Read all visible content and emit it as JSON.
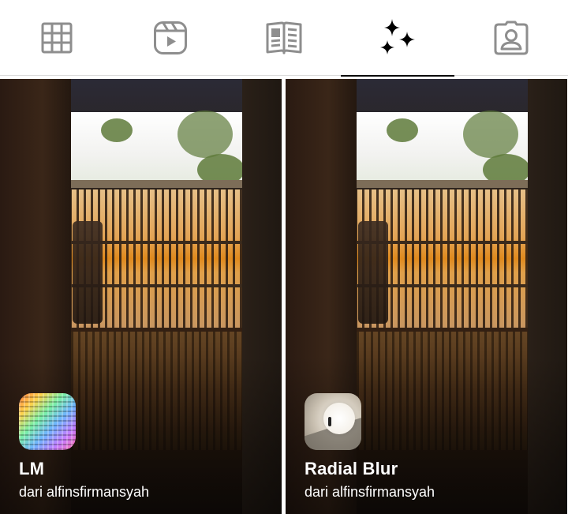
{
  "tabs": [
    {
      "id": "posts",
      "icon": "grid-icon",
      "active": false
    },
    {
      "id": "reels",
      "icon": "reels-icon",
      "active": false
    },
    {
      "id": "guides",
      "icon": "book-icon",
      "active": false
    },
    {
      "id": "effects",
      "icon": "sparkles-icon",
      "active": true
    },
    {
      "id": "tagged",
      "icon": "tagged-person-icon",
      "active": false
    }
  ],
  "effects": [
    {
      "name": "LM",
      "author": "dari alfinsfirmansyah",
      "icon": "lm-effect-icon"
    },
    {
      "name": "Radial Blur",
      "author": "dari alfinsfirmansyah",
      "icon": "radial-blur-effect-icon"
    }
  ],
  "colors": {
    "icon_gray": "#8e8e8e",
    "icon_active": "#000000",
    "tab_underline": "#000000",
    "text_on_media": "#ffffff"
  }
}
